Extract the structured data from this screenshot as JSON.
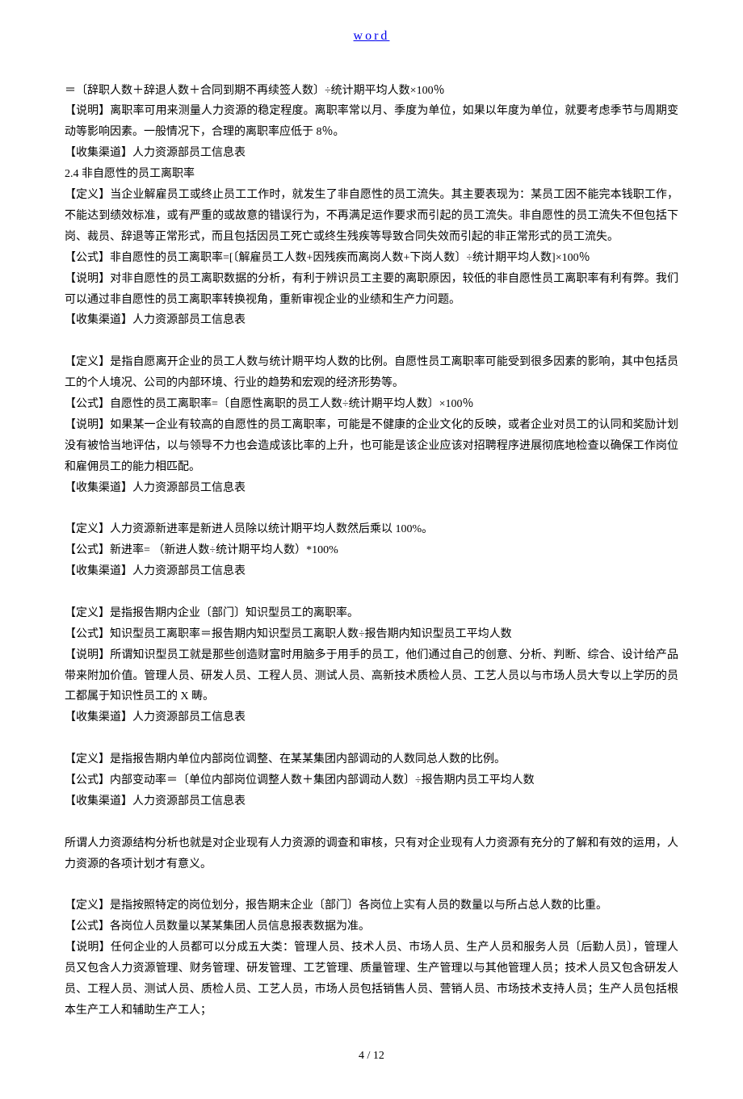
{
  "header": {
    "link_text": "word"
  },
  "paragraphs": [
    "＝〔辞职人数＋辞退人数＋合同到期不再续签人数〕÷统计期平均人数×100％",
    "【说明】离职率可用来测量人力资源的稳定程度。离职率常以月、季度为单位，如果以年度为单位，就要考虑季节与周期变动等影响因素。一般情况下，合理的离职率应低于 8％。",
    "【收集渠道】人力资源部员工信息表",
    "2.4 非自愿性的员工离职率",
    "【定义】当企业解雇员工或终止员工工作时，就发生了非自愿性的员工流失。其主要表现为：某员工因不能完本钱职工作，不能达到绩效标准，或有严重的或故意的错误行为，不再满足运作要求而引起的员工流失。非自愿性的员工流失不但包括下岗、裁员、辞退等正常形式，而且包括因员工死亡或终生残疾等导致合同失效而引起的非正常形式的员工流失。",
    "【公式】非自愿性的员工离职率=[〔解雇员工人数+因残疾而离岗人数+下岗人数〕÷统计期平均人数]×100％",
    "【说明】对非自愿性的员工离职数据的分析，有利于辨识员工主要的离职原因，较低的非自愿性员工离职率有利有弊。我们可以通过非自愿性的员工离职率转换视角，重新审视企业的业绩和生产力问题。",
    "【收集渠道】人力资源部员工信息表",
    "",
    "【定义】是指自愿离开企业的员工人数与统计期平均人数的比例。自愿性员工离职率可能受到很多因素的影响，其中包括员工的个人境况、公司的内部环境、行业的趋势和宏观的经济形势等。",
    "【公式】自愿性的员工离职率=〔自愿性离职的员工人数÷统计期平均人数〕×100％",
    "【说明】如果某一企业有较高的自愿性的员工离职率，可能是不健康的企业文化的反映，或者企业对员工的认同和奖励计划没有被恰当地评估，以与领导不力也会造成该比率的上升，也可能是该企业应该对招聘程序进展彻底地检查以确保工作岗位和雇佣员工的能力相匹配。",
    "【收集渠道】人力资源部员工信息表",
    "",
    "【定义】人力资源新进率是新进人员除以统计期平均人数然后乘以 100%。",
    "【公式】新进率=  （新进人数÷统计期平均人数）*100%",
    "【收集渠道】人力资源部员工信息表",
    "",
    "【定义】是指报告期内企业〔部门〕知识型员工的离职率。",
    "【公式】知识型员工离职率＝报告期内知识型员工离职人数÷报告期内知识型员工平均人数",
    "【说明】所谓知识型员工就是那些创造财富时用脑多于用手的员工，他们通过自己的创意、分析、判断、综合、设计给产品带来附加价值。管理人员、研发人员、工程人员、测试人员、高新技术质检人员、工艺人员以与市场人员大专以上学历的员工都属于知识性员工的 X 畴。",
    "【收集渠道】人力资源部员工信息表",
    "",
    "【定义】是指报告期内单位内部岗位调整、在某某集团内部调动的人数同总人数的比例。",
    "【公式】内部变动率＝〔单位内部岗位调整人数＋集团内部调动人数〕÷报告期内员工平均人数",
    "【收集渠道】人力资源部员工信息表",
    "",
    "所谓人力资源结构分析也就是对企业现有人力资源的调查和审核，只有对企业现有人力资源有充分的了解和有效的运用，人力资源的各项计划才有意义。",
    "",
    "【定义】是指按照特定的岗位划分，报告期末企业〔部门〕各岗位上实有人员的数量以与所占总人数的比重。",
    "【公式】各岗位人员数量以某某集团人员信息报表数据为准。",
    "【说明】任何企业的人员都可以分成五大类：管理人员、技术人员、市场人员、生产人员和服务人员〔后勤人员〕，管理人员又包含人力资源管理、财务管理、研发管理、工艺管理、质量管理、生产管理以与其他管理人员；技术人员又包含研发人员、工程人员、测试人员、质检人员、工艺人员，市场人员包括销售人员、营销人员、市场技术支持人员；生产人员包括根本生产工人和辅助生产工人；"
  ],
  "footer": {
    "page_indicator": "4 / 12"
  }
}
